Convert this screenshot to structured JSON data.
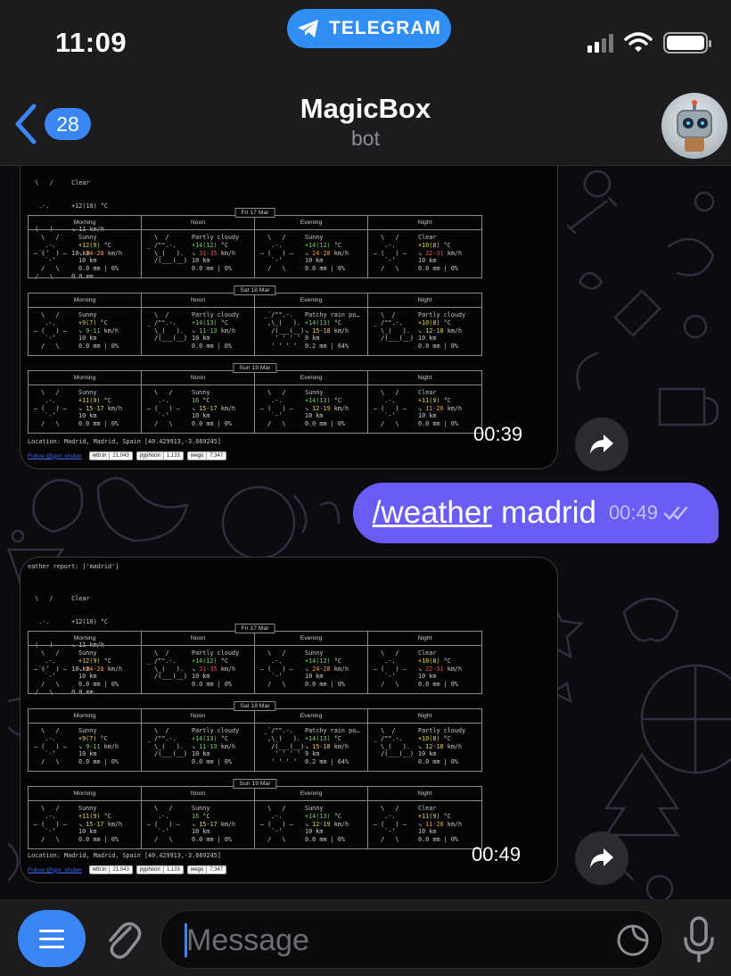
{
  "status_bar": {
    "time": "11:09",
    "app_pill": "TELEGRAM"
  },
  "header": {
    "back_count": "28",
    "title": "MagicBox",
    "subtitle": "bot"
  },
  "messages": {
    "first": {
      "time": "00:39",
      "current": [
        "  \\   /     Clear",
        "   .-.      +12(10) °C",
        "― (   ) ―   ↘ 11 km/h",
        "   `-’      10 km",
        "  /   \\     0.0 mm"
      ],
      "location": "Location: Madrid, Madrid, Spain [40.429913,-3.669245]"
    },
    "outgoing": {
      "command": "/weather",
      "argument": "madrid",
      "time": "00:49"
    },
    "second": {
      "time": "00:49",
      "header_line": "eather report: ['madrid']",
      "current": [
        "  \\   /     Clear",
        "   .-.      +12(10) °C",
        "― (   ) ―   ↘ 11 km/h",
        "   `-’      10 km",
        "  /   \\     0.0 mm"
      ],
      "location": "Location: Madrid, Madrid, Spain [40.429913,-3.669245]"
    }
  },
  "forecast": {
    "columns": [
      "Morning",
      "Noon",
      "Evening",
      "Night"
    ],
    "days": [
      {
        "label": "Fri 17 Mar",
        "cells": [
          {
            "art": [
              "  \\   /",
              "   .-.",
              "― (   ) ―",
              "   `-’",
              "  /   \\"
            ],
            "lines": [
              "Sunny",
              "+12(9) °C",
              "↘ 24-28 km/h",
              "10 km",
              "0.0 mm | 0%"
            ]
          },
          {
            "art": [
              "  \\  /",
              "_ /\"\".-.",
              "  \\_(   ).",
              "  /(___(__)",
              ""
            ],
            "lines": [
              "Partly cloudy",
              "+14(12) °C",
              "↘ 31-35 km/h",
              "10 km",
              "0.0 mm | 0%"
            ]
          },
          {
            "art": [
              "  \\   /",
              "   .-.",
              "― (   ) ―",
              "   `-’",
              "  /   \\"
            ],
            "lines": [
              "Sunny",
              "+14(12) °C",
              "↘ 24-28 km/h",
              "10 km",
              "0.0 mm | 0%"
            ]
          },
          {
            "art": [
              "  \\   /",
              "   .-.",
              "― (   ) ―",
              "   `-’",
              "  /   \\"
            ],
            "lines": [
              "Clear",
              "+10(8) °C",
              "↘ 22-31 km/h",
              "10 km",
              "0.0 mm | 0%"
            ]
          }
        ]
      },
      {
        "label": "Sat 18 Mar",
        "cells": [
          {
            "art": [
              "  \\   /",
              "   .-.",
              "― (   ) ―",
              "   `-’",
              "  /   \\"
            ],
            "lines": [
              "Sunny",
              "+9(7) °C",
              "↘ 9-11 km/h",
              "10 km",
              "0.0 mm | 0%"
            ]
          },
          {
            "art": [
              "  \\  /",
              "_ /\"\".-.",
              "  \\_(   ).",
              "  /(___(__)",
              ""
            ],
            "lines": [
              "Partly cloudy",
              "+14(13) °C",
              "↘ 11-13 km/h",
              "10 km",
              "0.0 mm | 0%"
            ]
          },
          {
            "art": [
              " _`/\"\".-.",
              "  ,\\_(   ).",
              "   /(___(__)",
              "    ‘ ‘ ‘ ‘",
              "   ‘ ‘ ‘ ‘"
            ],
            "lines": [
              "Patchy rain po…",
              "+14(13) °C",
              "↘ 15-18 km/h",
              "9 km",
              "0.2 mm | 64%"
            ]
          },
          {
            "art": [
              "  \\  /",
              "_ /\"\".-.",
              "  \\_(   ).",
              "  /(___(__)",
              ""
            ],
            "lines": [
              "Partly cloudy",
              "+10(8) °C",
              "↘ 12-18 km/h",
              "10 km",
              "0.0 mm | 0%"
            ]
          }
        ]
      },
      {
        "label": "Sun 19 Mar",
        "cells": [
          {
            "art": [
              "  \\   /",
              "   .-.",
              "― (   ) ―",
              "   `-’",
              "  /   \\"
            ],
            "lines": [
              "Sunny",
              "+11(9) °C",
              "↘ 15-17 km/h",
              "10 km",
              "0.0 mm | 0%"
            ]
          },
          {
            "art": [
              "  \\   /",
              "   .-.",
              "― (   ) ―",
              "   `-’",
              "  /   \\"
            ],
            "lines": [
              "Sunny",
              "16 °C",
              "↘ 15-17 km/h",
              "10 km",
              "0.0 mm | 0%"
            ]
          },
          {
            "art": [
              "  \\   /",
              "   .-.",
              "― (   ) ―",
              "   `-’",
              "  /   \\"
            ],
            "lines": [
              "Sunny",
              "+14(13) °C",
              "↘ 12-19 km/h",
              "10 km",
              "0.0 mm | 0%"
            ]
          },
          {
            "art": [
              "  \\   /",
              "   .-.",
              "― (   ) ―",
              "   `-’",
              "  /   \\"
            ],
            "lines": [
              "Clear",
              "+11(9) °C",
              "↘ 11-20 km/h",
              "10 km",
              "0.0 mm | 0%"
            ]
          }
        ]
      }
    ]
  },
  "footer_links": {
    "follow": "Follow @igor_chubin",
    "badges": [
      {
        "name": "wttr.in",
        "count": "21,043"
      },
      {
        "name": "pyphoon",
        "count": "1,133"
      },
      {
        "name": "wego",
        "count": "7,347"
      }
    ]
  },
  "composer": {
    "placeholder": "Message"
  },
  "colors": {
    "accent": "#3a86f5",
    "outgoing_bubble": "#6a5cf6",
    "telegram_pill": "#2f8ff5"
  }
}
